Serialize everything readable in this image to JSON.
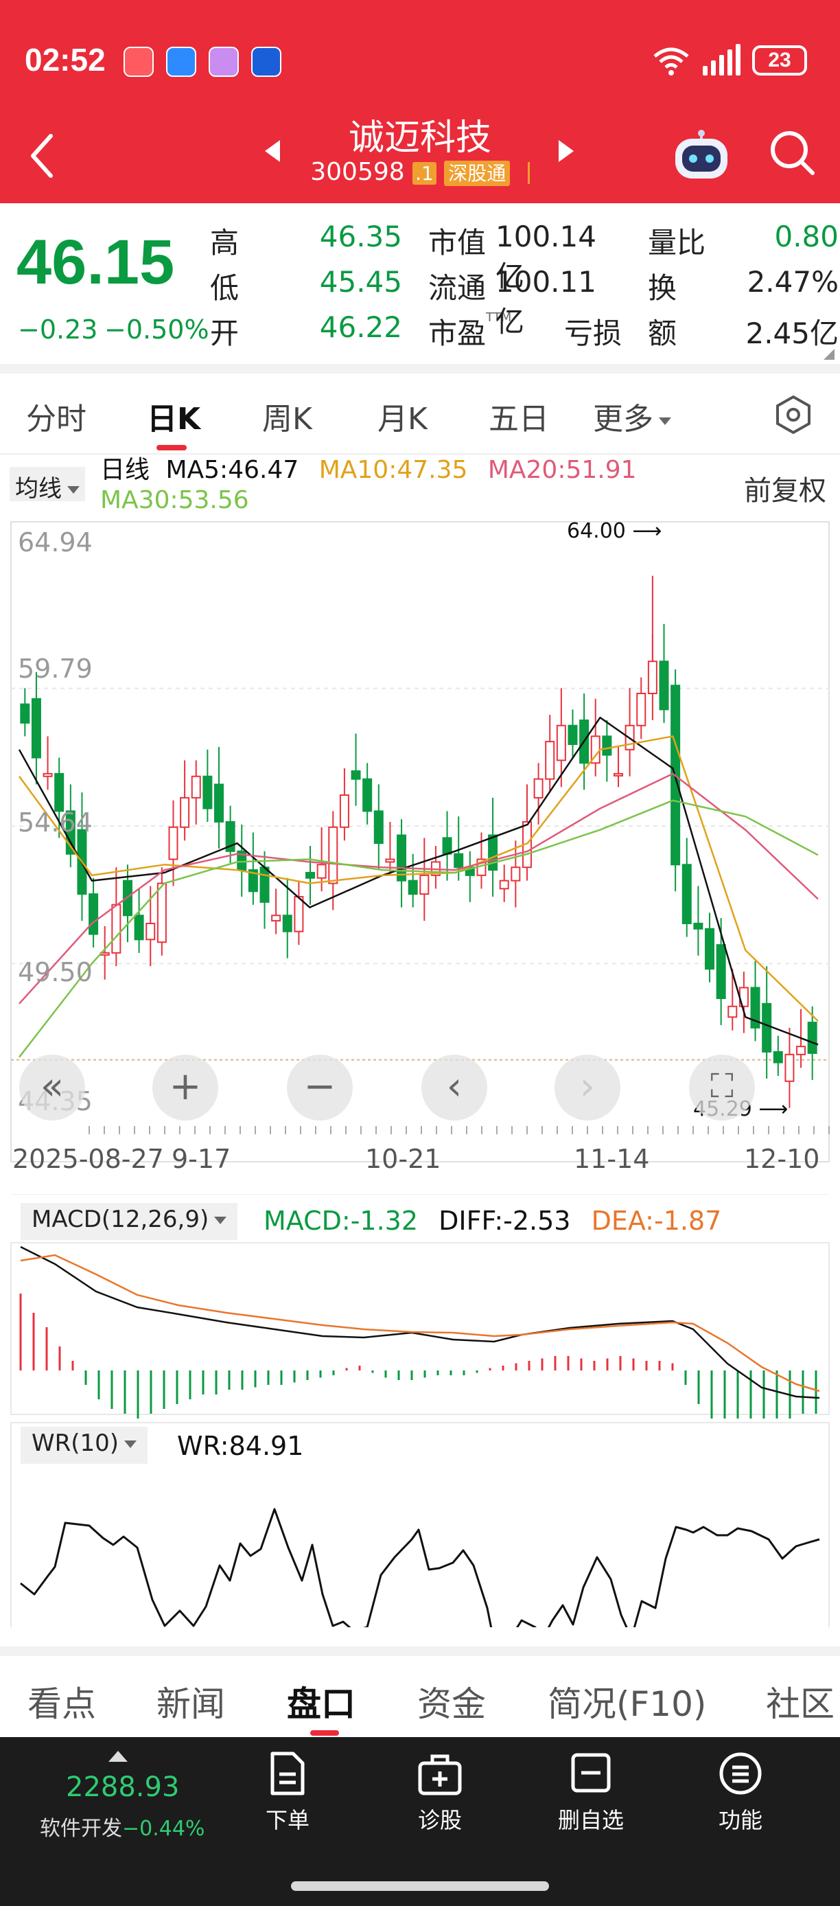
{
  "status_bar": {
    "time": "02:52",
    "battery": "23"
  },
  "header": {
    "name": "诚迈科技",
    "code": "300598",
    "code_suffix": ".1",
    "exchange_badge": "深股通"
  },
  "quote": {
    "price": "46.15",
    "change": "−0.23",
    "change_pct": "−0.50%",
    "stats": [
      {
        "label": "高",
        "value": "46.35"
      },
      {
        "label": "低",
        "value": "45.45"
      },
      {
        "label": "开",
        "value": "46.22"
      },
      {
        "label": "市值",
        "value": "100.14亿"
      },
      {
        "label": "流通",
        "value": "100.11亿"
      },
      {
        "label": "市盈",
        "sup": "TTM",
        "value": "亏损"
      },
      {
        "label": "量比",
        "value": "0.80"
      },
      {
        "label": "换",
        "value": "2.47%"
      },
      {
        "label": "额",
        "value": "2.45亿"
      }
    ]
  },
  "chart_tabs": [
    "分时",
    "日K",
    "周K",
    "月K",
    "五日",
    "更多"
  ],
  "ma_legend": {
    "selector": "均线",
    "type": "日线",
    "ma5": "MA5:46.47",
    "ma10": "MA10:47.35",
    "ma20": "MA20:51.91",
    "ma30": "MA30:53.56",
    "adjust": "前复权"
  },
  "kline": {
    "y_ticks": [
      "64.94",
      "59.79",
      "54.64",
      "49.50",
      "44.35"
    ],
    "x_ticks": [
      "2025-08-27",
      "9-17",
      "10-21",
      "11-14",
      "12-10"
    ],
    "high_label": "64.00",
    "low_label": "45.29"
  },
  "macd": {
    "selector": "MACD(12,26,9)",
    "macd": "MACD:-1.32",
    "diff": "DIFF:-2.53",
    "dea": "DEA:-1.87"
  },
  "wr": {
    "selector": "WR(10)",
    "value": "WR:84.91"
  },
  "bottom_tabs": [
    "看点",
    "新闻",
    "盘口",
    "资金",
    "简况(F10)",
    "社区"
  ],
  "bottom_nav": {
    "index_value": "2288.93",
    "index_name": "软件开发",
    "index_change": "−0.44%",
    "items": [
      "下单",
      "诊股",
      "删自选",
      "功能"
    ]
  },
  "colors": {
    "header_red": "#ea2b39",
    "up": "#e8323c",
    "down": "#0a9a42",
    "ma5": "#111111",
    "ma10": "#e0a21a",
    "ma20": "#e05a78",
    "ma30": "#7cc34a"
  },
  "chart_data": {
    "type": "line",
    "title": "",
    "x": [
      "2025-08-27",
      "9-17",
      "10-21",
      "11-14",
      "12-10"
    ],
    "ylim": [
      44.35,
      64.94
    ],
    "series": [
      {
        "name": "MA5",
        "values": [
          57.5,
          52.6,
          52.9,
          54.0,
          51.6,
          52.8,
          53.7,
          54.7,
          58.7,
          56.8,
          47.5,
          46.47
        ]
      },
      {
        "name": "MA10",
        "values": [
          56.5,
          52.8,
          53.2,
          53.0,
          52.5,
          52.8,
          52.9,
          54.0,
          57.5,
          58.0,
          50.0,
          47.35
        ]
      },
      {
        "name": "MA20",
        "values": [
          48.0,
          51.0,
          53.0,
          53.6,
          53.3,
          53.1,
          53.0,
          53.7,
          55.3,
          56.6,
          54.5,
          51.91
        ]
      },
      {
        "name": "MA30",
        "values": [
          46.0,
          49.5,
          52.5,
          53.3,
          53.4,
          53.0,
          52.9,
          53.6,
          54.5,
          55.6,
          55.0,
          53.56
        ]
      }
    ]
  }
}
